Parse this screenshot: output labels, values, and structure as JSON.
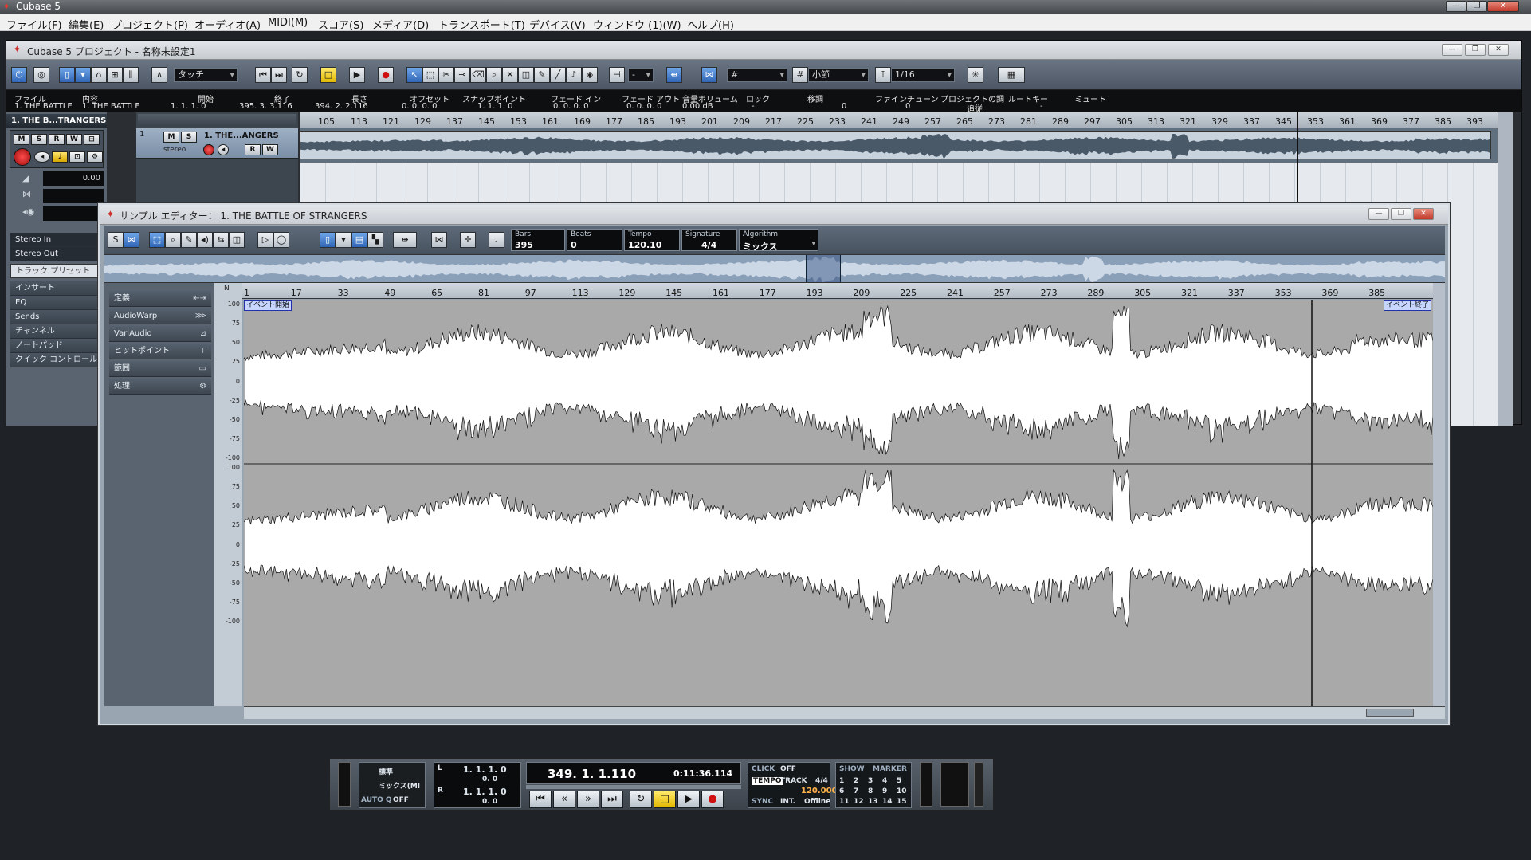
{
  "app": {
    "title": "Cubase 5"
  },
  "menu": [
    "ファイル(F)",
    "編集(E)",
    "プロジェクト(P)",
    "オーディオ(A)",
    "MIDI(M)",
    "スコア(S)",
    "メディア(D)",
    "トランスポート(T)",
    "デバイス(V)",
    "ウィンドウ (1)(W)",
    "ヘルプ(H)"
  ],
  "project": {
    "title": "Cubase 5 プロジェクト - 名称未設定1",
    "automation_mode": "タッチ",
    "grid_type": "小節",
    "quantize": "1/16",
    "info_headers": [
      "ファイル",
      "内容",
      "開始",
      "終了",
      "長さ",
      "オフセット",
      "スナップポイント",
      "フェード イン",
      "フェード アウト",
      "音量ボリューム",
      "ロック",
      "移調",
      "ファインチューン",
      "プロジェクトの調",
      "ルートキー",
      "ミュート"
    ],
    "info_values": [
      "1. THE BATTLE",
      "1. THE BATTLE",
      "1. 1. 1.   0",
      "395. 3. 3.116",
      "394. 2. 2.116",
      "0. 0. 0.   0",
      "1. 1. 1.   0",
      "0. 0. 0.   0",
      "0. 0. 0.   0",
      "0.00 dB",
      "-",
      "0",
      "0",
      "追従",
      "-",
      ""
    ],
    "inspector_title": "1. THE B...TRANGERS",
    "inspector_volume": "0.00",
    "inspector_routing": [
      "Stereo In",
      "Stereo Out"
    ],
    "inspector_preset": "トラック プリセット",
    "inspector_sections": [
      "インサート",
      "EQ",
      "Sends",
      "チャンネル",
      "ノートパッド",
      "クイック コントロール"
    ],
    "track": {
      "number": "1",
      "name": "1. THE...ANGERS",
      "type": "stereo"
    },
    "ruler_ticks": [
      "105",
      "113",
      "121",
      "129",
      "137",
      "145",
      "153",
      "161",
      "169",
      "177",
      "185",
      "193",
      "201",
      "209",
      "217",
      "225",
      "233",
      "241",
      "249",
      "257",
      "265",
      "273",
      "281",
      "289",
      "297",
      "305",
      "313",
      "321",
      "329",
      "337",
      "345",
      "353",
      "361",
      "369",
      "377",
      "385",
      "393"
    ]
  },
  "editor": {
    "title": "サンプル エディター： 1. THE BATTLE OF STRANGERS",
    "bars_label": "Bars",
    "bars": "395",
    "beats_label": "Beats",
    "beats": "0",
    "tempo_label": "Tempo",
    "tempo": "120.10",
    "signature_label": "Signature",
    "signature": "4/4",
    "algorithm_label": "Algorithm",
    "algorithm": "ミックス",
    "side_sections": [
      "定義",
      "AudioWarp",
      "VariAudio",
      "ヒットポイント",
      "範囲",
      "処理"
    ],
    "ruler_ticks": [
      "1",
      "17",
      "33",
      "49",
      "65",
      "81",
      "97",
      "113",
      "129",
      "145",
      "161",
      "177",
      "193",
      "209",
      "225",
      "241",
      "257",
      "273",
      "289",
      "305",
      "321",
      "337",
      "353",
      "369",
      "385"
    ],
    "scale": [
      "100",
      "75",
      "50",
      "25",
      "0",
      "-25",
      "-50",
      "-75",
      "-100"
    ],
    "event_start": "イベント開始",
    "event_end": "イベント終了"
  },
  "transport": {
    "mode": "標準",
    "cycle_mode": "ミックス(MI",
    "autoq": "AUTO Q",
    "autoq_state": "OFF",
    "left_locator": "1. 1. 1.   0",
    "right_locator": "1. 1. 1.   0",
    "sub1": "0.   0",
    "sub2": "0.   0",
    "position_bars": "349.  1.  1.110",
    "position_time": "0:11:36.114",
    "click_label": "CLICK",
    "click_state": "OFF",
    "tempo_label": "TEMPO",
    "tempo_mode": "TRACK",
    "signature": "4/4",
    "tempo": "120.000",
    "sync_label": "SYNC",
    "sync_mode": "INT.",
    "sync_state": "Offline",
    "show_label": "SHOW",
    "marker_label": "MARKER",
    "markers": [
      "1",
      "2",
      "3",
      "4",
      "5",
      "6",
      "7",
      "8",
      "9",
      "10",
      "11",
      "12",
      "13",
      "14",
      "15"
    ]
  },
  "colors": {
    "accent": "#2f65b5",
    "record": "#d01010",
    "cycle": "#e1b800"
  }
}
